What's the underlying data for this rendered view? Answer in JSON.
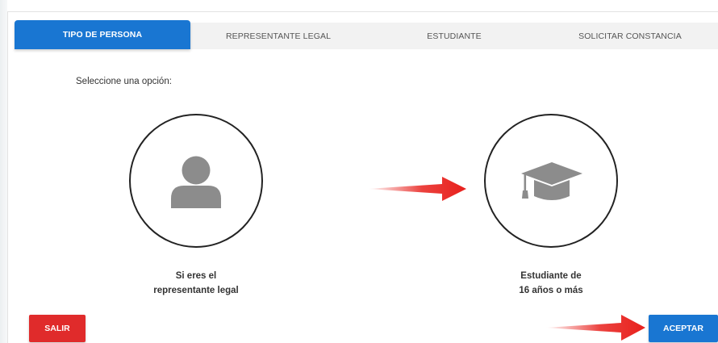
{
  "tabs": [
    {
      "label": "TIPO DE PERSONA",
      "active": true
    },
    {
      "label": "REPRESENTANTE LEGAL",
      "active": false
    },
    {
      "label": "ESTUDIANTE",
      "active": false
    },
    {
      "label": "SOLICITAR CONSTANCIA",
      "active": false
    }
  ],
  "instruction": "Seleccione una opción:",
  "options": [
    {
      "icon": "person-icon",
      "caption_line1": "Si eres el",
      "caption_line2": "representante legal"
    },
    {
      "icon": "graduation-cap-icon",
      "caption_line1": "Estudiante de",
      "caption_line2": "16 años o más"
    }
  ],
  "buttons": {
    "exit_label": "SALIR",
    "accept_label": "ACEPTAR"
  },
  "colors": {
    "primary": "#1976d2",
    "danger": "#e02b2b",
    "icon_gray": "#8c8c8c",
    "arrow_red": "#e8201c"
  }
}
